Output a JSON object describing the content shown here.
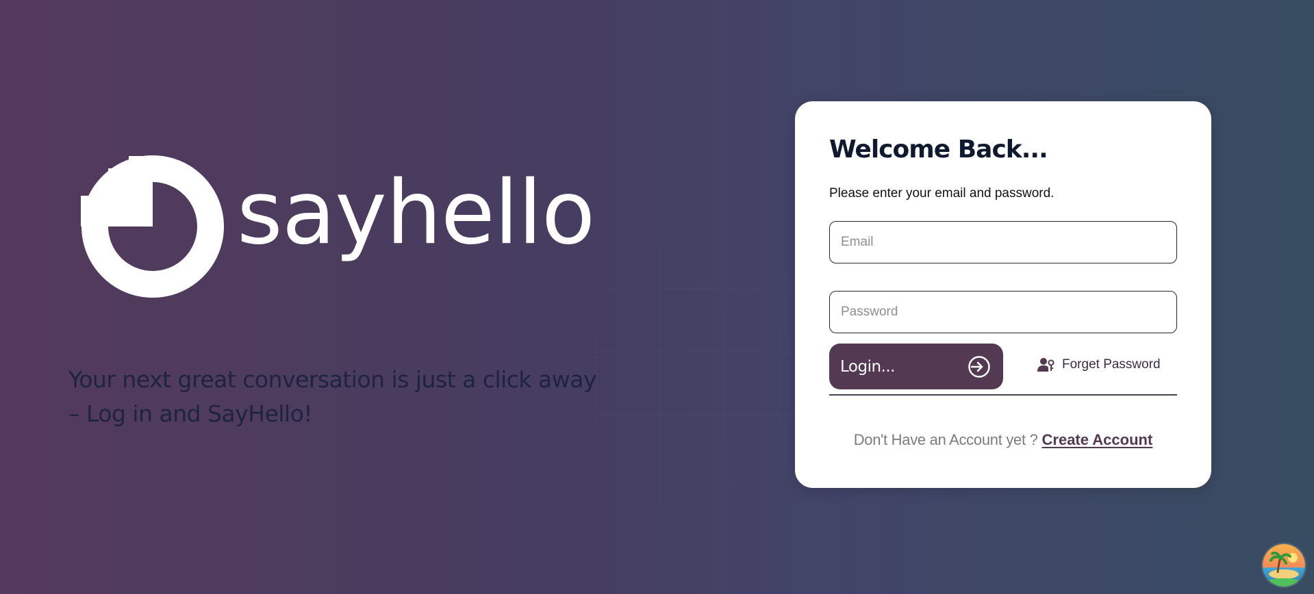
{
  "brand": {
    "name": "sayhello",
    "tagline": "Your next great conversation is just a click away – Log in and SayHello!"
  },
  "login_card": {
    "title": "Welcome Back...",
    "subtitle": "Please enter your email and password.",
    "email_placeholder": "Email",
    "email_value": "",
    "password_placeholder": "Password",
    "password_value": "",
    "login_label": "Login...",
    "login_icon": "sign-in-icon",
    "forgot_label": "Forget Password",
    "forgot_icon": "user-key-icon",
    "signup_prompt": "Don't Have an Account yet ?",
    "signup_link": "Create Account"
  },
  "corner_badge": {
    "icon": "beach-island-icon"
  },
  "colors": {
    "accent": "#533952",
    "card_bg": "#ffffff",
    "title": "#0f1a30",
    "background_left": "#543a5c",
    "background_right": "#384c62"
  }
}
